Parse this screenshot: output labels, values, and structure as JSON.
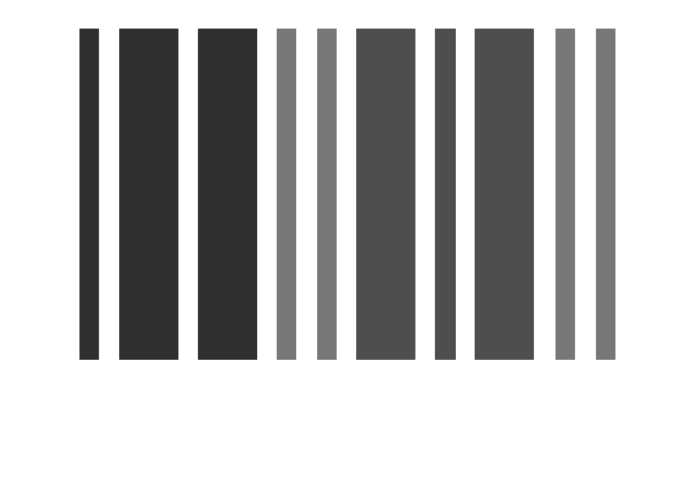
{
  "stripes": [
    {
      "shade": "#2f2f2f",
      "weight": "thin"
    },
    {
      "shade": "#2f2f2f",
      "weight": "wide"
    },
    {
      "shade": "#2f2f2f",
      "weight": "wide"
    },
    {
      "shade": "#777777",
      "weight": "thin"
    },
    {
      "shade": "#777777",
      "weight": "thin"
    },
    {
      "shade": "#4e4e4e",
      "weight": "wide"
    },
    {
      "shade": "#4e4e4e",
      "weight": "thin"
    },
    {
      "shade": "#4e4e4e",
      "weight": "wide"
    },
    {
      "shade": "#777777",
      "weight": "thin"
    },
    {
      "shade": "#777777",
      "weight": "thin"
    }
  ],
  "colors": {
    "background": "#ffffff",
    "dark": "#2f2f2f",
    "medium": "#4e4e4e",
    "light": "#777777"
  }
}
